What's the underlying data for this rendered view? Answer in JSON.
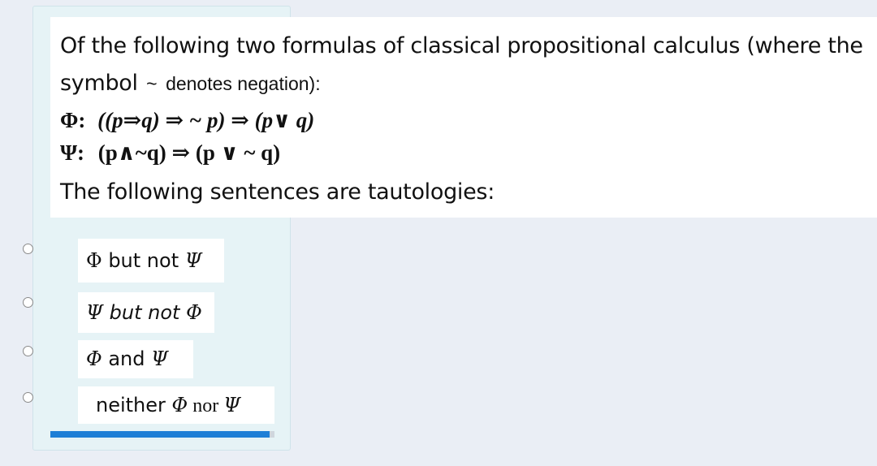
{
  "question": {
    "line1": "Of the following two formulas of classical propositional calculus (where the",
    "line2_word": "symbol",
    "line2_tilde": "~",
    "line2_rest": "denotes negation):",
    "phi_label": "Φ:",
    "phi_formula": "((p⇒q) ⇒ ~ p) ⇒ (p∨ q)",
    "psi_label": "Ψ:",
    "psi_formula": "(p∧~q)  ⇒ (p ∨ ~ q)",
    "prompt": "The following sentences are tautologies:"
  },
  "options": [
    {
      "phi": "Φ",
      "text": " but not ",
      "psi": "Ψ"
    },
    {
      "psi": "Ψ",
      "text": " but not  ",
      "phi": "Φ"
    },
    {
      "phi": "Φ",
      "text": " and  ",
      "psi": "Ψ"
    },
    {
      "prefix": "neither ",
      "phi": "Φ",
      "text": " nor   ",
      "psi": "Ψ"
    }
  ],
  "progress": {
    "fraction": 0.98
  },
  "colors": {
    "page_bg": "#eaeef5",
    "card_bg": "#e6f3f6",
    "progress": "#1e7fd6"
  }
}
